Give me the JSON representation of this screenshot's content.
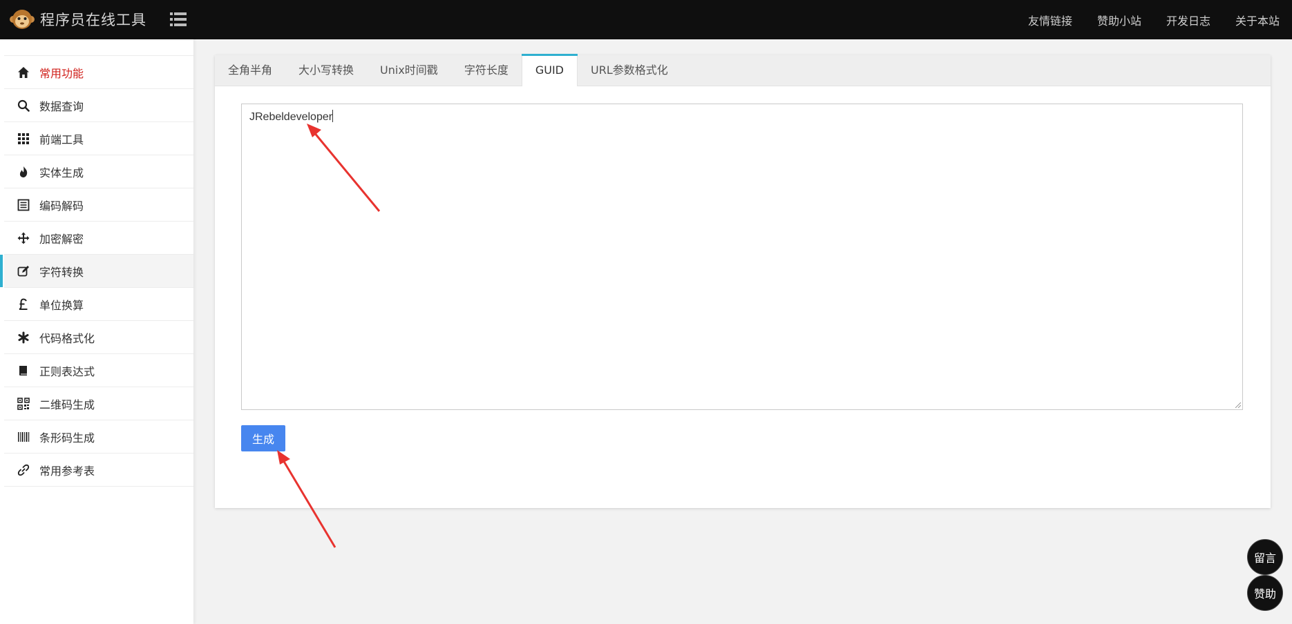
{
  "header": {
    "title": "程序员在线工具",
    "logo_icon": "monkey-logo-icon",
    "menu_icon": "list-menu-icon",
    "nav": [
      {
        "label": "友情链接"
      },
      {
        "label": "赞助小站"
      },
      {
        "label": "开发日志"
      },
      {
        "label": "关于本站"
      }
    ]
  },
  "sidebar": {
    "items": [
      {
        "label": "常用功能",
        "icon": "home-icon"
      },
      {
        "label": "数据查询",
        "icon": "search-icon"
      },
      {
        "label": "前端工具",
        "icon": "grid-icon"
      },
      {
        "label": "实体生成",
        "icon": "fire-icon"
      },
      {
        "label": "编码解码",
        "icon": "list-box-icon"
      },
      {
        "label": "加密解密",
        "icon": "move-arrows-icon"
      },
      {
        "label": "字符转换",
        "icon": "edit-icon"
      },
      {
        "label": "单位换算",
        "icon": "pound-icon"
      },
      {
        "label": "代码格式化",
        "icon": "asterisk-icon"
      },
      {
        "label": "正则表达式",
        "icon": "book-icon"
      },
      {
        "label": "二维码生成",
        "icon": "qrcode-icon"
      },
      {
        "label": "条形码生成",
        "icon": "barcode-icon"
      },
      {
        "label": "常用参考表",
        "icon": "link-icon"
      }
    ],
    "active_index": 6,
    "highlight_index": 0,
    "active_color": "#2fb0d0",
    "highlight_color": "#d0201b"
  },
  "main": {
    "tabs": [
      {
        "label": "全角半角"
      },
      {
        "label": "大小写转换"
      },
      {
        "label": "Unix时间戳"
      },
      {
        "label": "字符长度"
      },
      {
        "label": "GUID"
      },
      {
        "label": "URL参数格式化"
      }
    ],
    "active_tab": 4,
    "editor_value": "JRebeldeveloper",
    "generate_label": "生成",
    "button_color": "#4786ef"
  },
  "floating": {
    "message_label": "留言",
    "sponsor_label": "赞助"
  }
}
